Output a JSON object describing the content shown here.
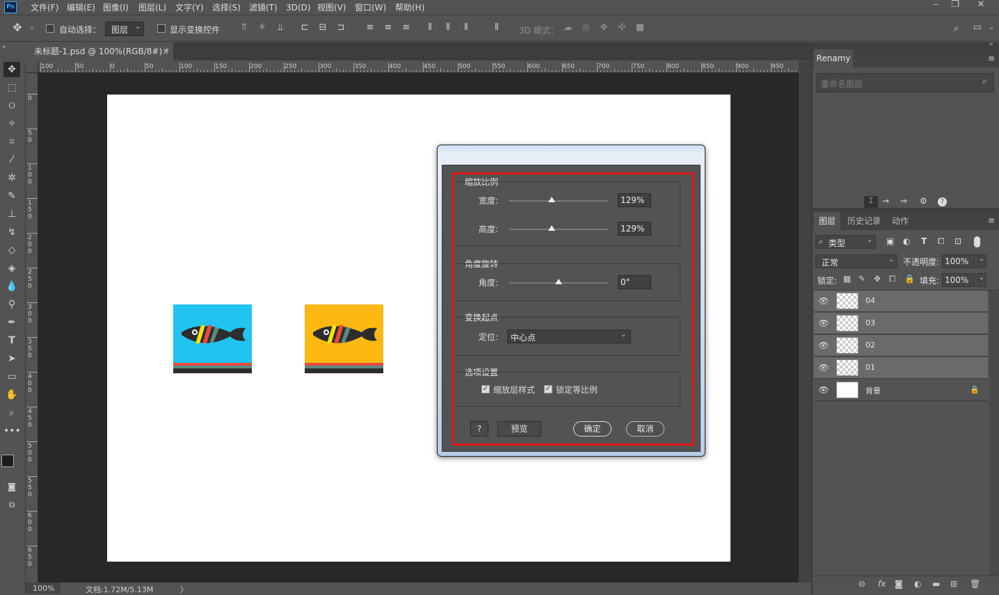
{
  "app": {
    "logo": "Ps"
  },
  "menubar": {
    "items": [
      "文件(F)",
      "编辑(E)",
      "图像(I)",
      "图层(L)",
      "文字(Y)",
      "选择(S)",
      "滤镜(T)",
      "3D(D)",
      "视图(V)",
      "窗口(W)",
      "帮助(H)"
    ]
  },
  "window_controls": {
    "minimize": "–",
    "restore": "❐",
    "close": "✕"
  },
  "options": {
    "auto_select_label": "自动选择：",
    "auto_select_target": "图层",
    "show_transform_label": "显示变换控件",
    "mode3d_label": "3D 模式："
  },
  "doc_tab": {
    "title": "未标题-1.psd @ 100%(RGB/8#) *",
    "close": "×"
  },
  "rulers": {
    "h_labels": [
      "100",
      "50",
      "0",
      "50",
      "100",
      "150",
      "200",
      "250",
      "300",
      "350",
      "400",
      "450",
      "500",
      "550",
      "600",
      "650",
      "700",
      "750",
      "800",
      "850",
      "900",
      "950"
    ],
    "v_labels": [
      "0",
      "5\n0",
      "1\n0\n0",
      "1\n5\n0",
      "2\n0\n0",
      "2\n5\n0",
      "3\n0\n0",
      "3\n5\n0",
      "4\n0\n0",
      "4\n5\n0",
      "5\n0\n0",
      "5\n5\n0",
      "6\n0\n0",
      "6\n5\n0"
    ]
  },
  "status": {
    "zoom": "100%",
    "doc_info": "文档:1.72M/5.13M",
    "arrow": "〉"
  },
  "renamy_panel": {
    "tab": "Renamy",
    "search_placeholder": "重命名图层"
  },
  "layers_panel": {
    "tabs": [
      "图层",
      "历史记录",
      "动作"
    ],
    "filter_kind": "类型",
    "blend_mode": "正常",
    "opacity_label": "不透明度:",
    "opacity_value": "100%",
    "lock_label": "锁定:",
    "fill_label": "填充:",
    "fill_value": "100%",
    "layers": [
      {
        "name": "04",
        "selected": true
      },
      {
        "name": "03",
        "selected": true
      },
      {
        "name": "02",
        "selected": true
      },
      {
        "name": "01",
        "selected": true
      },
      {
        "name": "背景",
        "selected": false,
        "locked": true
      }
    ]
  },
  "canvas_images": [
    {
      "bg": "#21c4f0"
    },
    {
      "bg": "#fdb813"
    }
  ],
  "dialog": {
    "scale_group": "缩放比例",
    "width_label": "宽度:",
    "width_value": "129%",
    "width_level": 0.43,
    "height_label": "高度:",
    "height_value": "129%",
    "height_level": 0.43,
    "rotate_group": "角度旋转",
    "angle_label": "角度:",
    "angle_value": "0°",
    "angle_level": 0.5,
    "origin_group": "变换起点",
    "position_label": "定位:",
    "position_value": "中心点",
    "options_group": "选项设置",
    "scale_styles_label": "缩放层样式",
    "scale_styles_checked": true,
    "lock_ratio_label": "锁定等比例",
    "lock_ratio_checked": true,
    "help_label": "?",
    "preview_label": "预览",
    "ok_label": "确定",
    "cancel_label": "取消"
  },
  "colors": {
    "highlight_red": "#e01717",
    "accent": "#31a8ff"
  }
}
